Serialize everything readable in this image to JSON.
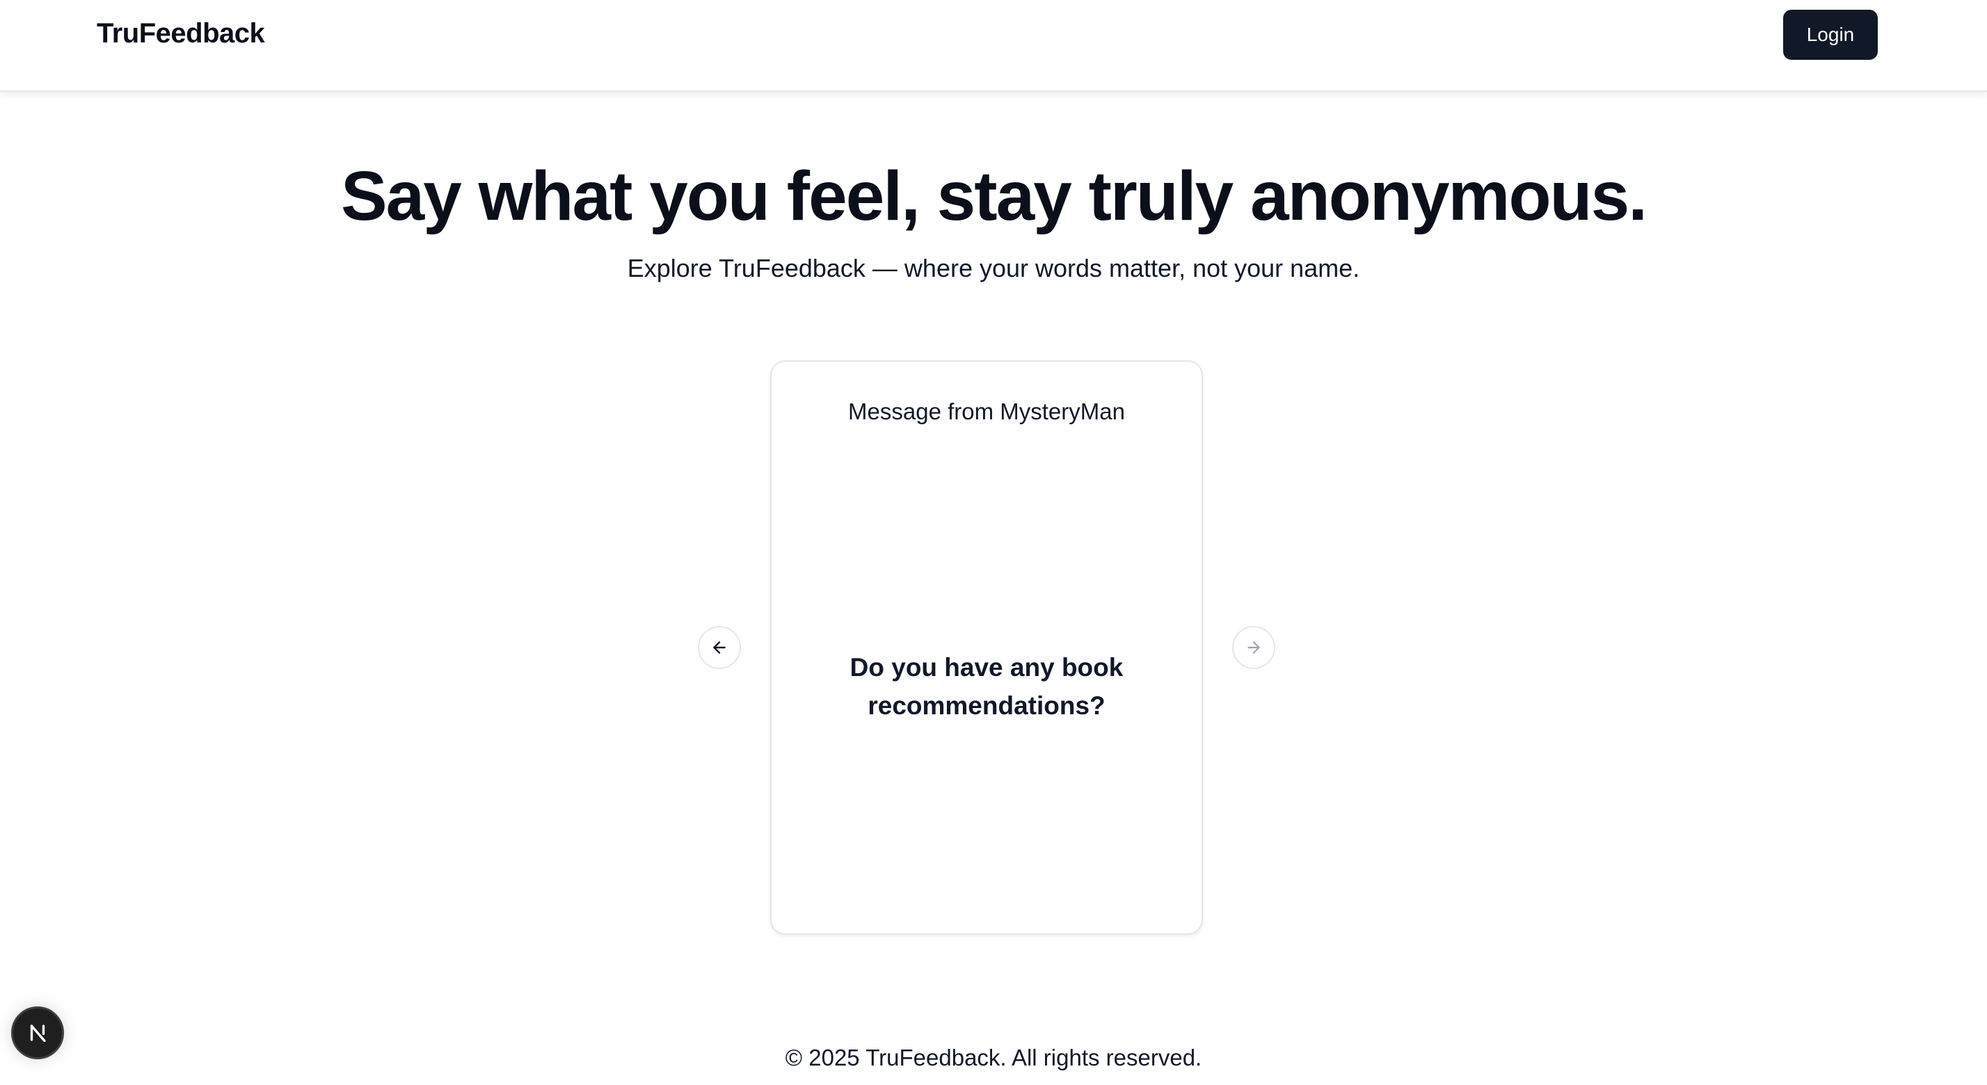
{
  "header": {
    "brand": "TruFeedback",
    "login_label": "Login"
  },
  "hero": {
    "title": "Say what you feel, stay truly anonymous.",
    "subtitle": "Explore TruFeedback — where your words matter, not your name."
  },
  "carousel": {
    "card_header": "Message from MysteryMan",
    "card_message": "Do you have any book recommendations?",
    "prev_icon": "arrow-left-icon",
    "next_icon": "arrow-right-icon"
  },
  "footer": {
    "copyright": "© 2025 TruFeedback. All rights reserved."
  },
  "dev_badge": {
    "icon": "nextjs-logo-icon"
  },
  "colors": {
    "primary_button": "#111827",
    "text": "#0b0f1a",
    "border": "#e5e7eb"
  }
}
